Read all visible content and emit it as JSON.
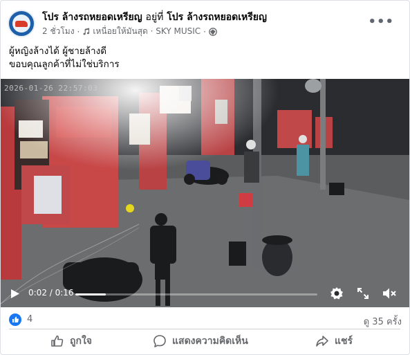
{
  "post": {
    "page_name": "โปร ล้างรถหยอดเหรียญ",
    "at_text": "อยู่ที่",
    "location": "โปร ล้างรถหยอดเหรียญ",
    "time": "2 ชั่วโมง",
    "music": "เหนื่อยให้มันสุด · SKY MUSIC",
    "caption_line1": "ผู้หญิงล้างได้ ผู้ชายล้างดี",
    "caption_line2": "ขอบคุณลูกค้าที่ไม่ใช่บริการ"
  },
  "video": {
    "timestamp": "2026-01-26 22:57:03",
    "current_time": "0:02",
    "duration": "0:16",
    "time_display": "0:02 / 0:16",
    "progress": 0.125
  },
  "stats": {
    "likes": "4",
    "views": "ดู 35 ครั้ง"
  },
  "actions": {
    "like": "ถูกใจ",
    "comment": "แสดงความคิดเห็น",
    "share": "แชร์"
  },
  "colors": {
    "accent": "#1877f2",
    "meta_text": "#65676b"
  }
}
